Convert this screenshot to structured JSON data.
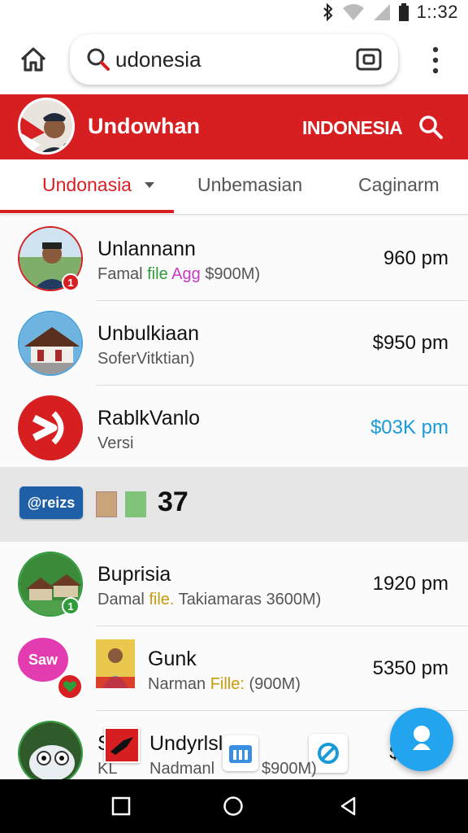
{
  "status_bar": {
    "time": "1::32",
    "icons": [
      "bluetooth-icon",
      "wifi-icon",
      "signal-icon",
      "battery-icon"
    ]
  },
  "browser": {
    "url_text": "udonesia",
    "icons": [
      "home-icon",
      "search-icon",
      "camera-icon",
      "overflow-menu-icon"
    ]
  },
  "header": {
    "title": "Undowhan",
    "country": "INDONESIA",
    "accent_color": "#d71f22"
  },
  "tabs": [
    {
      "label": "Undonasia",
      "active": true
    },
    {
      "label": "Unbemasian",
      "active": false
    },
    {
      "label": "Caginarm",
      "active": false
    }
  ],
  "list": [
    {
      "title": "Unlannann",
      "sub_parts": [
        {
          "text": "Famal ",
          "color": "#555555"
        },
        {
          "text": "file ",
          "color": "#2e9c3a"
        },
        {
          "text": "Agg ",
          "color": "#c43bc4"
        },
        {
          "text": "$900M)",
          "color": "#555555"
        }
      ],
      "price": "960 pm",
      "price_color": "#111111",
      "badge": "1"
    },
    {
      "title": "Unbulkiaan",
      "sub_parts": [
        {
          "text": "SoferVitktian)",
          "color": "#555555"
        }
      ],
      "price": "$950 pm",
      "price_color": "#111111"
    },
    {
      "title": "RablkVanlo",
      "sub_parts": [
        {
          "text": "Versi",
          "color": "#555555"
        }
      ],
      "price": "$03K pm",
      "price_color": "#1a9ad6"
    },
    {
      "title": "Buprisia",
      "sub_parts": [
        {
          "text": "Damal ",
          "color": "#555555"
        },
        {
          "text": "file. ",
          "color": "#c89b0a"
        },
        {
          "text": "Takiamaras 3600M)",
          "color": "#555555"
        }
      ],
      "price": "1920 pm",
      "price_color": "#111111",
      "badge": "1"
    },
    {
      "title": "Gunk",
      "sub_parts": [
        {
          "text": "Narman ",
          "color": "#555555"
        },
        {
          "text": "Fille: ",
          "color": "#c89b0a"
        },
        {
          "text": "(900M)",
          "color": "#555555"
        }
      ],
      "price": "5350 pm",
      "price_color": "#111111"
    },
    {
      "title": "Undyrlsl",
      "sub_parts": [
        {
          "text": "Nadmanl ",
          "color": "#555555"
        },
        {
          "text": "$900M)",
          "color": "#555555"
        }
      ],
      "price": "$2",
      "price_color": "#111111"
    }
  ],
  "banner": {
    "logo_text": "@reizs",
    "count": "37"
  },
  "saw_label": "Saw",
  "row6_prefix": "Si",
  "row6_sub_prefix": "KL"
}
